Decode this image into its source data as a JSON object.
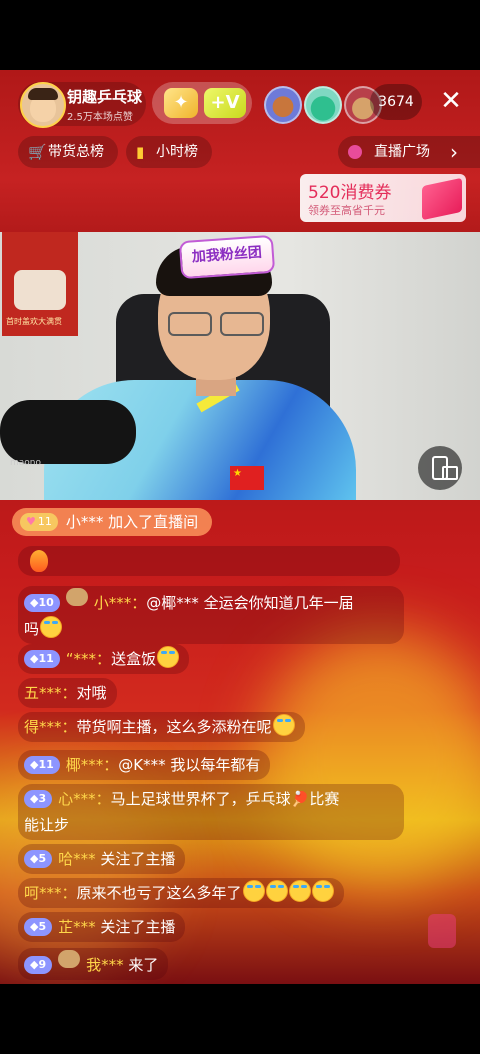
{
  "host": {
    "name": "钥趣乒乓球",
    "likes": "2.5万本场点赞"
  },
  "badges": {
    "b1": "✦",
    "b2": "+V"
  },
  "viewer_count": "3674",
  "close_glyph": "✕",
  "pills": {
    "goods": "带货总榜",
    "hourly": "小时榜",
    "square": "直播广场",
    "square_arrow": "›"
  },
  "coupon": {
    "title": "520消费券",
    "subtitle": "领券至高省千元"
  },
  "video": {
    "fan_badge": "加我粉丝团",
    "poster_text": "首时盖欢大满贯",
    "mic_brand": "maono"
  },
  "join": {
    "level": "11",
    "text": "小*** 加入了直播间"
  },
  "messages": [
    {
      "level": "10",
      "fan": true,
      "user": "小***：",
      "content": "@椰*** 全运会你知道几年一届",
      "line2": "吗",
      "emoji": 1
    },
    {
      "level": "11",
      "fan": false,
      "user": "“***：",
      "content": "送盒饭",
      "emoji": 1
    },
    {
      "level": "",
      "fan": false,
      "user": "五***：",
      "content": "对哦",
      "emoji": 0
    },
    {
      "level": "",
      "fan": false,
      "user": "得***：",
      "content": "带货啊主播，这么多添粉在呢",
      "emoji": 1
    },
    {
      "level": "11",
      "fan": false,
      "user": "椰***：",
      "content": "@K*** 我以每年都有",
      "emoji": 0
    },
    {
      "level": "3",
      "fan": false,
      "user": "心***：",
      "content": "马上足球世界杯了，乒乓球🏓比赛",
      "line2": "能让步",
      "emoji": 0
    },
    {
      "level": "5",
      "fan": false,
      "user": "哈***",
      "content": " 关注了主播",
      "emoji": 0
    },
    {
      "level": "",
      "fan": false,
      "user": "呵***：",
      "content": "原来不也亏了这么多年了",
      "emoji": 4
    },
    {
      "level": "5",
      "fan": false,
      "user": "芷***",
      "content": " 关注了主播",
      "emoji": 0
    },
    {
      "level": "9",
      "fan": true,
      "user": "我***",
      "content": " 来了",
      "emoji": 0
    }
  ]
}
